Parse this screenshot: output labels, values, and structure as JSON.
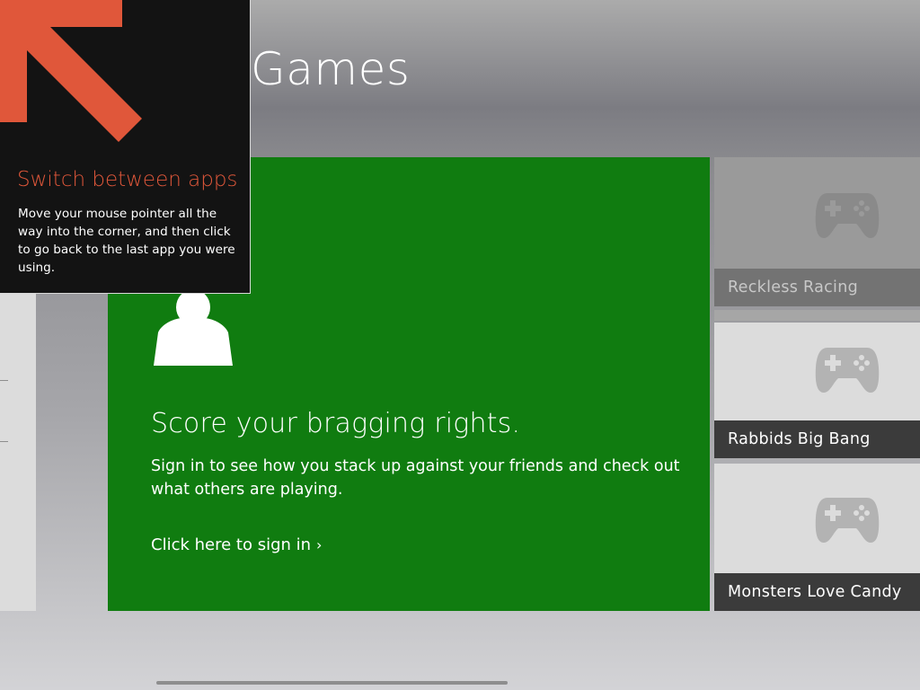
{
  "app": {
    "title": "Games"
  },
  "promo": {
    "headline": "Score your bragging rights.",
    "body": "Sign in to see how you stack up against your friends and check out what others are playing.",
    "signin_link": "Click here to sign in",
    "signin_chevron": "›",
    "accent_color": "#107c10",
    "icon": "person-icon"
  },
  "games": [
    {
      "name": "Reckless Racing",
      "icon": "game-controller-icon"
    },
    {
      "name": "Rabbids Big Bang",
      "icon": "game-controller-icon"
    },
    {
      "name": "Monsters Love Candy",
      "icon": "game-controller-icon"
    }
  ],
  "tip": {
    "title": "Switch between apps",
    "body": "Move your mouse pointer all the way into the corner, and then click to go back to the last app you were using.",
    "accent_color": "#e0573a",
    "icon": "corner-arrow-icon"
  }
}
